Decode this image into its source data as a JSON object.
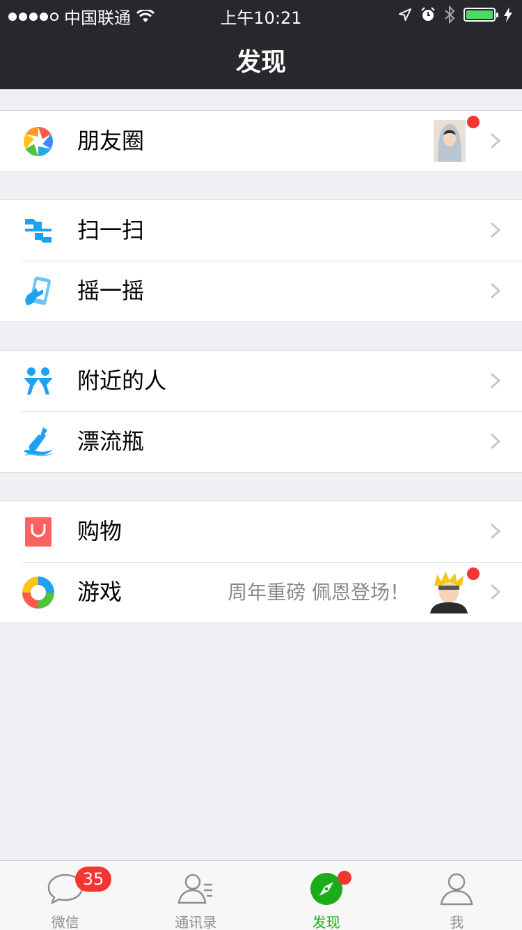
{
  "status_bar": {
    "carrier": "中国联通",
    "time": "上午10:21"
  },
  "header": {
    "title": "发现"
  },
  "groups": [
    {
      "items": [
        {
          "label": "朋友圈",
          "icon": "moments-icon",
          "has_thumb": true,
          "has_dot": true
        }
      ]
    },
    {
      "items": [
        {
          "label": "扫一扫",
          "icon": "scan-icon"
        },
        {
          "label": "摇一摇",
          "icon": "shake-icon"
        }
      ]
    },
    {
      "items": [
        {
          "label": "附近的人",
          "icon": "nearby-people-icon"
        },
        {
          "label": "漂流瓶",
          "icon": "drift-bottle-icon"
        }
      ]
    },
    {
      "items": [
        {
          "label": "购物",
          "icon": "shopping-bag-icon"
        },
        {
          "label": "游戏",
          "icon": "games-icon",
          "subtext": "周年重磅 佩恩登场！",
          "has_thumb": true,
          "has_dot": true
        }
      ]
    }
  ],
  "tab_bar": {
    "tabs": [
      {
        "label": "微信",
        "icon": "chat-bubble-icon",
        "badge": "35"
      },
      {
        "label": "通讯录",
        "icon": "contacts-icon"
      },
      {
        "label": "发现",
        "icon": "compass-icon",
        "active": true
      },
      {
        "label": "我",
        "icon": "person-icon"
      }
    ]
  },
  "colors": {
    "header_bg": "#28282c",
    "accent_green": "#1aad19",
    "badge_red": "#f43530",
    "page_bg": "#efeff4"
  }
}
